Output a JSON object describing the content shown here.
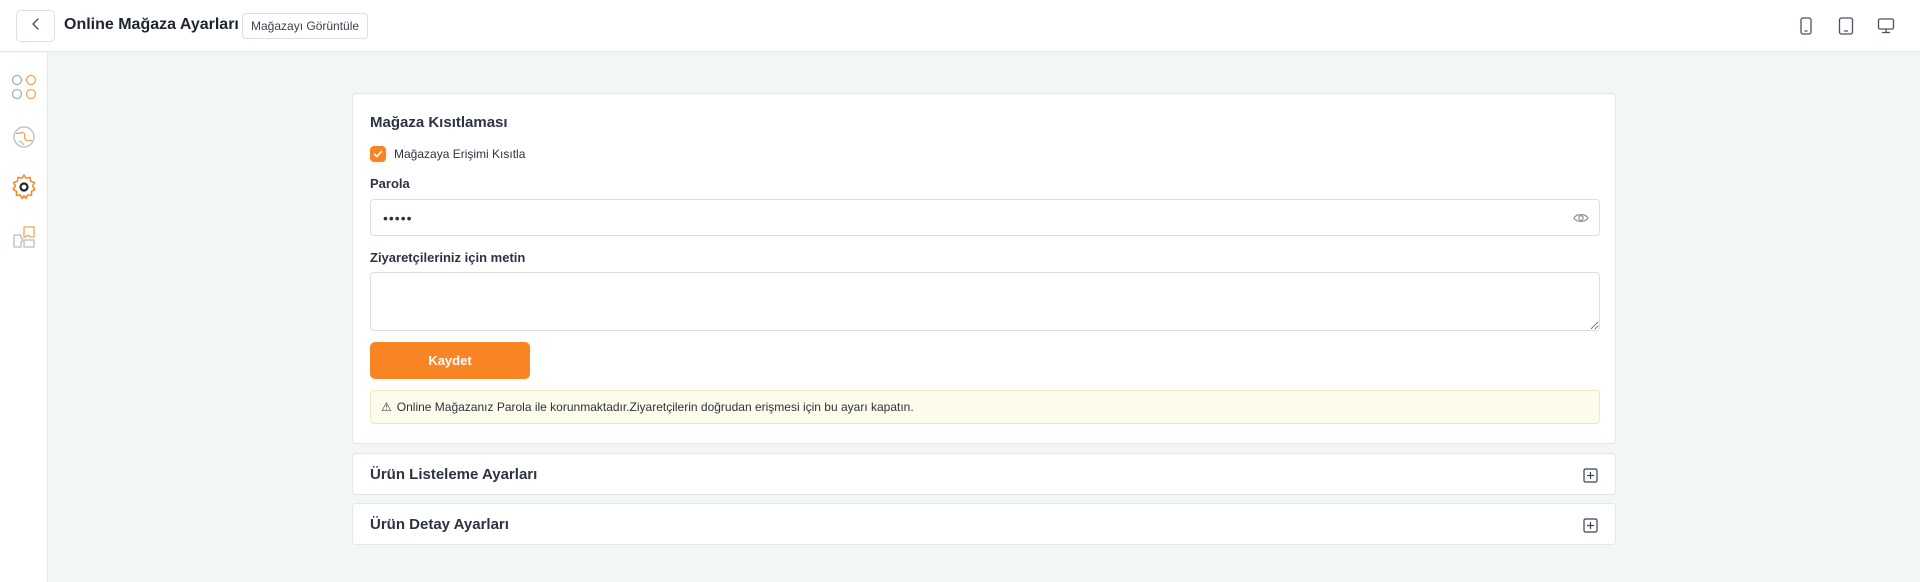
{
  "header": {
    "title": "Online Mağaza Ayarları",
    "view_store_label": "Mağazayı Görüntüle",
    "back_icon": "chevron-left-icon",
    "device_icons": [
      "mobile-icon",
      "tablet-icon",
      "desktop-icon"
    ]
  },
  "sidebar": {
    "items": [
      {
        "icon": "apps-grid-icon",
        "active": false
      },
      {
        "icon": "globe-icon",
        "active": false
      },
      {
        "icon": "gear-icon",
        "active": true
      },
      {
        "icon": "puzzle-icon",
        "active": false
      }
    ]
  },
  "restriction": {
    "title": "Mağaza Kısıtlaması",
    "checkbox_label": "Mağazaya Erişimi Kısıtla",
    "checkbox_checked": true,
    "password_label": "Parola",
    "password_value": "12345",
    "visitor_text_label": "Ziyaretçileriniz için metin",
    "visitor_text_value": "",
    "save_label": "Kaydet",
    "alert_icon": "⚠",
    "alert_text": "Online Mağazanız Parola ile korunmaktadır.Ziyaretçilerin doğrudan erişmesi için bu ayarı kapatın."
  },
  "sections": [
    {
      "title": "Ürün Listeleme Ayarları",
      "expanded": false
    },
    {
      "title": "Ürün Detay Ayarları",
      "expanded": false
    }
  ],
  "colors": {
    "accent": "#f98424",
    "background": "#f3f6f7",
    "alert_background": "#fdfbe9"
  }
}
